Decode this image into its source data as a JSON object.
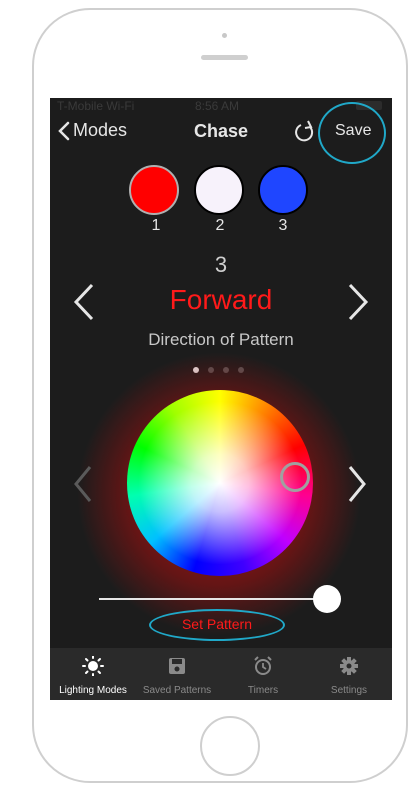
{
  "status_bar": {
    "carrier": "T-Mobile Wi-Fi",
    "time": "8:56 AM"
  },
  "nav": {
    "back_label": "Modes",
    "title": "Chase",
    "save_label": "Save"
  },
  "colors": {
    "swatches": [
      {
        "number": "1",
        "color": "#ff0000"
      },
      {
        "number": "2",
        "color": "#f7f2fb"
      },
      {
        "number": "3",
        "color": "#1f46ff"
      }
    ],
    "selected": "1"
  },
  "pattern": {
    "number": "3",
    "name": "Forward",
    "description": "Direction of Pattern",
    "page_dots": 4,
    "active_dot": 1
  },
  "brightness": {
    "value": 1.0
  },
  "set_pattern_label": "Set Pattern",
  "tabs": [
    {
      "label": "Lighting Modes",
      "icon": "sun-icon",
      "active": true
    },
    {
      "label": "Saved Patterns",
      "icon": "floppy-disk-icon",
      "active": false
    },
    {
      "label": "Timers",
      "icon": "alarm-clock-icon",
      "active": false
    },
    {
      "label": "Settings",
      "icon": "gear-icon",
      "active": false
    }
  ],
  "accent_color": "#ff1a1a"
}
